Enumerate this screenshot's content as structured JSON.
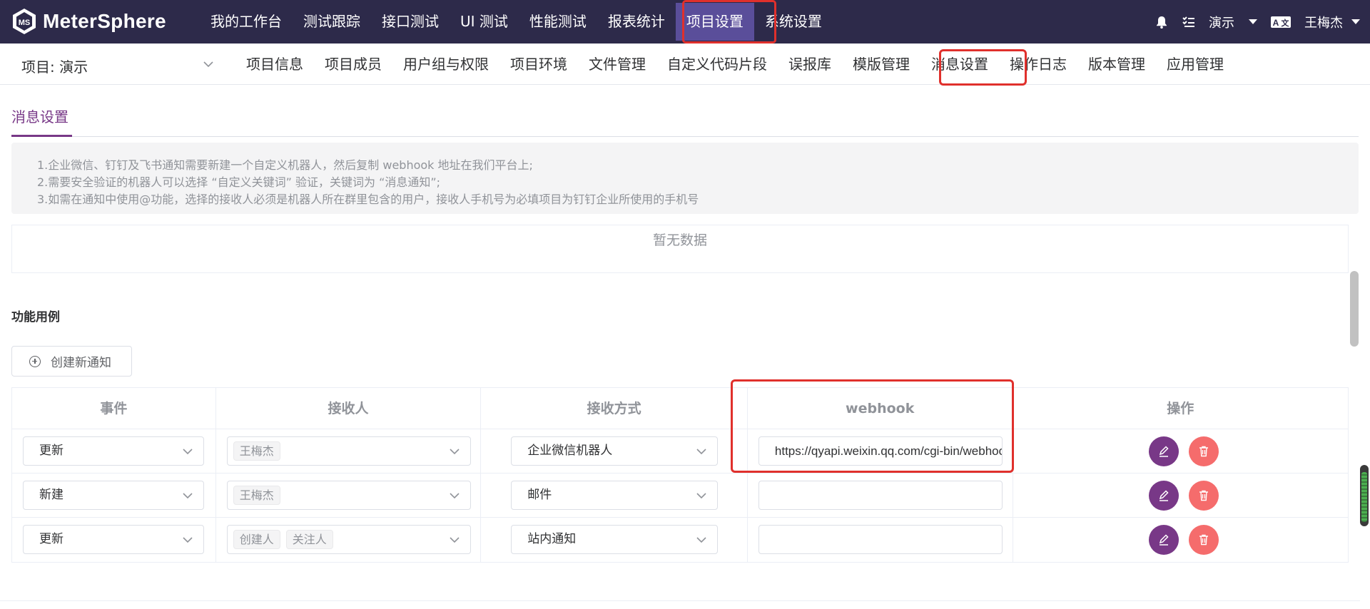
{
  "app": {
    "brand": "MeterSphere"
  },
  "topnav": {
    "items": [
      "我的工作台",
      "测试跟踪",
      "接口测试",
      "UI 测试",
      "性能测试",
      "报表统计",
      "项目设置",
      "系统设置"
    ],
    "active_index": 6
  },
  "topright": {
    "workspace": "演示",
    "user": "王梅杰"
  },
  "subnav": {
    "project_label": "项目: 演示",
    "items": [
      "项目信息",
      "项目成员",
      "用户组与权限",
      "项目环境",
      "文件管理",
      "自定义代码片段",
      "误报库",
      "模版管理",
      "消息设置",
      "操作日志",
      "版本管理",
      "应用管理"
    ],
    "active_index": 8
  },
  "page": {
    "tab": "消息设置",
    "tips": [
      "1.企业微信、钉钉及飞书通知需要新建一个自定义机器人，然后复制 webhook 地址在我们平台上;",
      "2.需要安全验证的机器人可以选择 “自定义关键词” 验证，关键词为 “消息通知”;",
      "3.如需在通知中使用@功能，选择的接收人必须是机器人所在群里包含的用户，接收人手机号为必填项目为钉钉企业所使用的手机号"
    ],
    "empty_text": "暂无数据",
    "section_title": "功能用例",
    "create_button": "创建新通知"
  },
  "table": {
    "columns": [
      "事件",
      "接收人",
      "接收方式",
      "webhook",
      "操作"
    ],
    "rows": [
      {
        "event": "更新",
        "receivers": [
          "王梅杰"
        ],
        "method": "企业微信机器人",
        "webhook": "https://qyapi.weixin.qq.com/cgi-bin/webhook/send"
      },
      {
        "event": "新建",
        "receivers": [
          "王梅杰"
        ],
        "method": "邮件",
        "webhook": ""
      },
      {
        "event": "更新",
        "receivers": [
          "创建人",
          "关注人"
        ],
        "method": "站内通知",
        "webhook": ""
      }
    ]
  },
  "colors": {
    "topbar_bg": "#2d2a4a",
    "active_nav_bg": "#5a4e9a",
    "accent_purple": "#783887",
    "danger_red": "#f56c6c",
    "highlight_red": "#e0302c"
  },
  "icons": [
    "bell-icon",
    "task-list-icon",
    "language-icon",
    "chevron-down-icon",
    "plus-circle-icon",
    "edit-icon",
    "delete-icon"
  ]
}
